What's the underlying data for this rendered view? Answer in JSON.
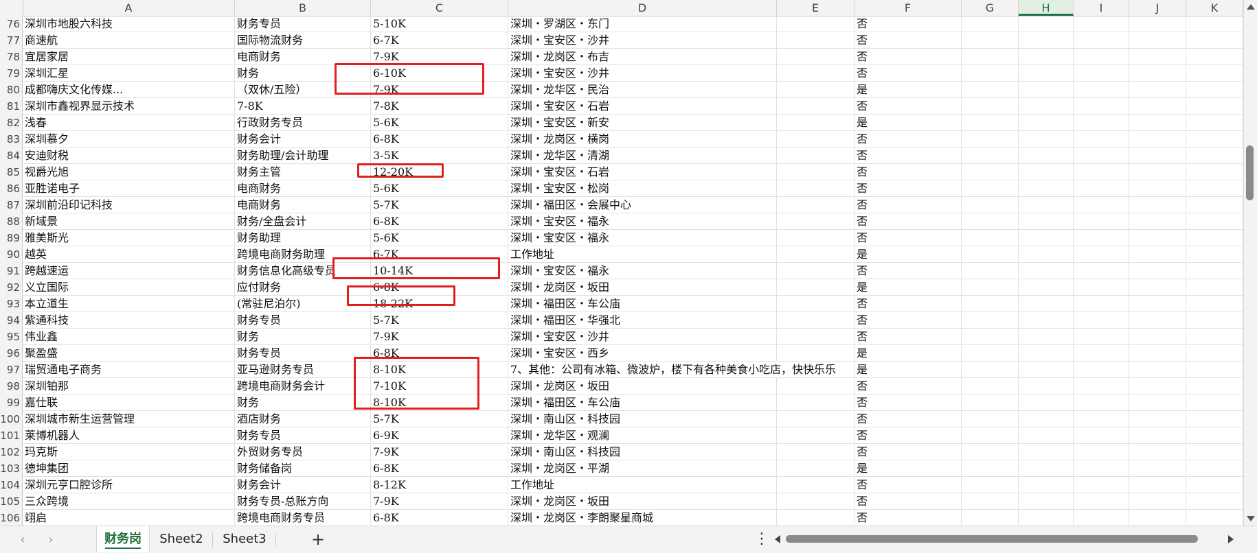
{
  "columns": [
    "A",
    "B",
    "C",
    "D",
    "E",
    "F",
    "G",
    "H",
    "I",
    "J",
    "K"
  ],
  "selected_column": "H",
  "rows": [
    {
      "num": "76",
      "a": "深圳市地股六科技",
      "b": "财务专员",
      "c": "5-10K",
      "d": "深圳・罗湖区・东门",
      "f": "否"
    },
    {
      "num": "77",
      "a": "商速航",
      "b": "国际物流财务",
      "c": "6-7K",
      "d": "深圳・宝安区・沙井",
      "f": "否"
    },
    {
      "num": "78",
      "a": "宜居家居",
      "b": "电商财务",
      "c": "7-9K",
      "d": "深圳・龙岗区・布吉",
      "f": "否"
    },
    {
      "num": "79",
      "a": "深圳汇星",
      "b": "财务",
      "c": "6-10K",
      "d": "深圳・宝安区・沙井",
      "f": "否"
    },
    {
      "num": "80",
      "a": "成都嗨庆文化传媒...",
      "b": "（双休/五险）",
      "c": "7-9K",
      "d": "深圳・龙华区・民治",
      "f": "是"
    },
    {
      "num": "81",
      "a": "深圳市鑫视界显示技术",
      "b": "7-8K",
      "c": "7-8K",
      "d": "深圳・宝安区・石岩",
      "f": "否"
    },
    {
      "num": "82",
      "a": "浅春",
      "b": "行政财务专员",
      "c": "5-6K",
      "d": "深圳・宝安区・新安",
      "f": "是"
    },
    {
      "num": "83",
      "a": "深圳慕夕",
      "b": "财务会计",
      "c": "6-8K",
      "d": "深圳・龙岗区・横岗",
      "f": "否"
    },
    {
      "num": "84",
      "a": "安迪财税",
      "b": "财务助理/会计助理",
      "c": "3-5K",
      "d": "深圳・龙华区・清湖",
      "f": "否"
    },
    {
      "num": "85",
      "a": "视爵光旭",
      "b": "财务主管",
      "c": "12-20K",
      "d": "深圳・宝安区・石岩",
      "f": "否"
    },
    {
      "num": "86",
      "a": "亚胜诺电子",
      "b": "电商财务",
      "c": "5-6K",
      "d": "深圳・宝安区・松岗",
      "f": "否"
    },
    {
      "num": "87",
      "a": "深圳前沿印记科技",
      "b": "电商财务",
      "c": "5-7K",
      "d": "深圳・福田区・会展中心",
      "f": "否"
    },
    {
      "num": "88",
      "a": "新域景",
      "b": "财务/全盘会计",
      "c": "6-8K",
      "d": "深圳・宝安区・福永",
      "f": "否"
    },
    {
      "num": "89",
      "a": "雅美斯光",
      "b": "财务助理",
      "c": "5-6K",
      "d": "深圳・宝安区・福永",
      "f": "否"
    },
    {
      "num": "90",
      "a": "越英",
      "b": "跨境电商财务助理",
      "c": "6-7K",
      "d": "工作地址",
      "f": "是"
    },
    {
      "num": "91",
      "a": "跨越速运",
      "b": "财务信息化高级专员",
      "c": "10-14K",
      "d": "深圳・宝安区・福永",
      "f": "否"
    },
    {
      "num": "92",
      "a": "义立国际",
      "b": "应付财务",
      "c": "6-8K",
      "d": "深圳・龙岗区・坂田",
      "f": "是"
    },
    {
      "num": "93",
      "a": "本立道生",
      "b": "(常驻尼泊尔)",
      "c": "18-22K",
      "d": "深圳・福田区・车公庙",
      "f": "否"
    },
    {
      "num": "94",
      "a": "紫通科技",
      "b": "财务专员",
      "c": "5-7K",
      "d": "深圳・福田区・华强北",
      "f": "否"
    },
    {
      "num": "95",
      "a": "伟业鑫",
      "b": "财务",
      "c": "7-9K",
      "d": "深圳・宝安区・沙井",
      "f": "否"
    },
    {
      "num": "96",
      "a": "聚盈盛",
      "b": "财务专员",
      "c": "6-8K",
      "d": "深圳・宝安区・西乡",
      "f": "是"
    },
    {
      "num": "97",
      "a": "瑞贸通电子商务",
      "b": "亚马逊财务专员",
      "c": "8-10K",
      "d": "7、其他：公司有冰箱、微波炉，楼下有各种美食小吃店，快快乐乐",
      "f": "是"
    },
    {
      "num": "98",
      "a": "深圳铂那",
      "b": "跨境电商财务会计",
      "c": "7-10K",
      "d": "深圳・龙岗区・坂田",
      "f": "否"
    },
    {
      "num": "99",
      "a": "嘉仕联",
      "b": "财务",
      "c": "8-10K",
      "d": "深圳・福田区・车公庙",
      "f": "否"
    },
    {
      "num": "100",
      "a": "深圳城市新生运营管理",
      "b": "酒店财务",
      "c": "5-7K",
      "d": "深圳・南山区・科技园",
      "f": "否"
    },
    {
      "num": "101",
      "a": "莱博机器人",
      "b": "财务专员",
      "c": "6-9K",
      "d": "深圳・龙华区・观澜",
      "f": "否"
    },
    {
      "num": "102",
      "a": "玛克斯",
      "b": "外贸财务专员",
      "c": "7-9K",
      "d": "深圳・南山区・科技园",
      "f": "否"
    },
    {
      "num": "103",
      "a": "德坤集团",
      "b": "财务储备岗",
      "c": "6-8K",
      "d": "深圳・龙岗区・平湖",
      "f": "是"
    },
    {
      "num": "104",
      "a": "深圳元亨口腔诊所",
      "b": "财务会计",
      "c": "8-12K",
      "d": "工作地址",
      "f": "否"
    },
    {
      "num": "105",
      "a": "三众跨境",
      "b": "财务专员-总账方向",
      "c": "7-9K",
      "d": "深圳・龙岗区・坂田",
      "f": "否"
    },
    {
      "num": "106",
      "a": "翊启",
      "b": "跨境电商财务专员",
      "c": "6-8K",
      "d": "深圳・龙岗区・李朗聚星商城",
      "f": "否"
    }
  ],
  "sheet_tabs": [
    {
      "label": "财务岗",
      "active": true
    },
    {
      "label": "Sheet2",
      "active": false
    },
    {
      "label": "Sheet3",
      "active": false
    }
  ],
  "icons": {
    "prev_sheet": "chevron-left-icon",
    "next_sheet": "chevron-right-icon",
    "add_sheet": "plus-icon",
    "more": "more-vertical-icon"
  },
  "add_sheet_label": "+",
  "more_label": "⋮",
  "prev_label": "‹",
  "next_label": "›",
  "colors": {
    "accent": "#217346",
    "annotation": "#e02020"
  }
}
